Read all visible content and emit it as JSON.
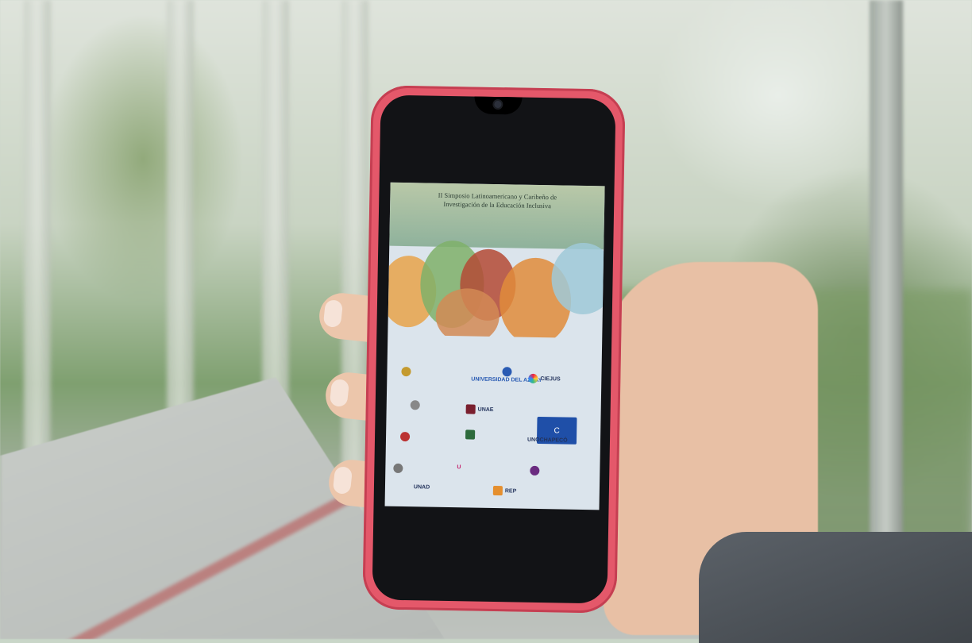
{
  "photo": {
    "subject": "hand-holding-smartphone",
    "phone_case_color": "#e4586a",
    "sleeve_color": "#4a4f55"
  },
  "poster": {
    "title_line1": "II Simposio Latinoamericano y Caribeño de",
    "title_line2": "Investigación de la Educación Inclusiva",
    "logos": [
      {
        "text": "UNIVERSIDAD DEL AZUAY",
        "color": "#2a5bb3"
      },
      {
        "text": "CIEJUS",
        "color": "#1f3b7a"
      },
      {
        "text": "UNAE",
        "color": "#1f3b7a"
      },
      {
        "text": "UNOCHAPECÓ",
        "color": "#1f3b7a"
      },
      {
        "text": "REP",
        "color": "#1f3b7a"
      },
      {
        "text": "UNAD",
        "color": "#2a5bb3"
      }
    ]
  }
}
